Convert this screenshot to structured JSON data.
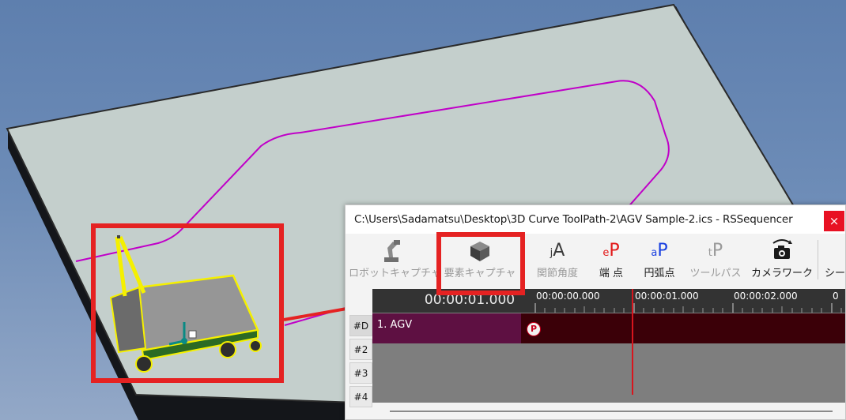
{
  "window": {
    "title": "C:\\Users\\Sadamatsu\\Desktop\\3D Curve ToolPath-2\\AGV Sample-2.ics - RSSequencer",
    "close_glyph": "×"
  },
  "toolbar": {
    "items": [
      {
        "label": "ロボットキャプチャ",
        "icon": "robot-arm-icon",
        "enabled": false
      },
      {
        "label": "要素キャプチャ",
        "icon": "cube-icon",
        "enabled": false
      },
      {
        "label": "関節角度",
        "icon": "jA",
        "enabled": false
      },
      {
        "label": "端 点",
        "icon": "eP",
        "enabled": true
      },
      {
        "label": "円弧点",
        "icon": "aP",
        "enabled": true
      },
      {
        "label": "ツールパス",
        "icon": "tP",
        "enabled": false
      },
      {
        "label": "カメラワーク",
        "icon": "camera-icon",
        "enabled": true
      },
      {
        "label": "シー",
        "icon": "",
        "enabled": true
      }
    ]
  },
  "icon_glyphs": {
    "jA": {
      "small": "j",
      "big": "A"
    },
    "eP": {
      "small": "e",
      "big": "P"
    },
    "aP": {
      "small": "a",
      "big": "P"
    },
    "tP": {
      "small": "t",
      "big": "P"
    }
  },
  "timeline": {
    "current_time": "00:00:01.000",
    "ruler": [
      "00:00:00.000",
      "00:00:01.000",
      "00:00:02.000",
      "0"
    ],
    "rows": [
      "#D",
      "#2",
      "#3",
      "#4"
    ],
    "clip_label": "1.  AGV",
    "marker_label": "P"
  },
  "colors": {
    "highlight": "#e52222",
    "path": "#c000c8",
    "agv_outline": "#f5f000",
    "clip": "#5e1042",
    "track_bg": "#3b0008",
    "playhead": "#d8151d"
  }
}
